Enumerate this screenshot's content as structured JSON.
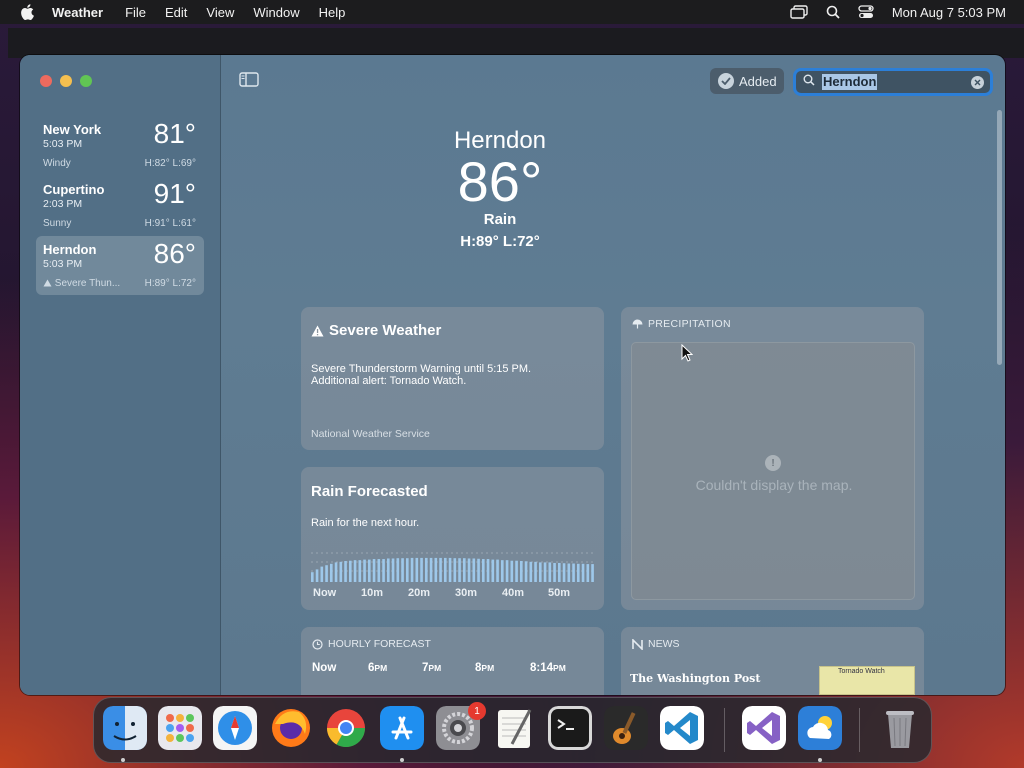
{
  "menubar": {
    "app_name": "Weather",
    "items": [
      "File",
      "Edit",
      "View",
      "Window",
      "Help"
    ],
    "clock": "Mon Aug 7  5:03 PM"
  },
  "sidebar": {
    "cities": [
      {
        "name": "New York",
        "time": "5:03 PM",
        "temp": "81°",
        "condition": "Windy",
        "hilo": "H:82°  L:69°"
      },
      {
        "name": "Cupertino",
        "time": "2:03 PM",
        "temp": "91°",
        "condition": "Sunny",
        "hilo": "H:91°  L:61°"
      },
      {
        "name": "Herndon",
        "time": "5:03 PM",
        "temp": "86°",
        "condition": "Severe Thun...",
        "hilo": "H:89°  L:72°"
      }
    ]
  },
  "toolbar": {
    "added_label": "Added",
    "search_value": "Herndon"
  },
  "current": {
    "city": "Herndon",
    "temp": "86°",
    "condition": "Rain",
    "hilo": "H:89°  L:72°"
  },
  "severe": {
    "title": "Severe Weather",
    "line1": "Severe Thunderstorm Warning until 5:15 PM.",
    "line2": "Additional alert: Tornado Watch.",
    "source": "National Weather Service"
  },
  "rain": {
    "title": "Rain Forecasted",
    "desc": "Rain for the next hour.",
    "ticks": [
      "Now",
      "10m",
      "20m",
      "30m",
      "40m",
      "50m"
    ],
    "intensity": [
      0.35,
      0.45,
      0.55,
      0.6,
      0.65,
      0.7,
      0.72,
      0.75,
      0.76,
      0.78,
      0.78,
      0.8,
      0.8,
      0.82,
      0.82,
      0.82,
      0.84,
      0.84,
      0.85,
      0.85,
      0.85,
      0.86,
      0.86,
      0.86,
      0.86,
      0.86,
      0.86,
      0.86,
      0.86,
      0.86,
      0.85,
      0.85,
      0.85,
      0.84,
      0.84,
      0.83,
      0.82,
      0.82,
      0.8,
      0.8,
      0.78,
      0.78,
      0.76,
      0.76,
      0.75,
      0.74,
      0.72,
      0.72,
      0.7,
      0.7,
      0.7,
      0.68,
      0.68,
      0.67,
      0.66,
      0.66,
      0.65,
      0.65,
      0.64,
      0.64
    ]
  },
  "precipitation": {
    "header": "PRECIPITATION",
    "message": "Couldn't display the map."
  },
  "hourly": {
    "header": "HOURLY FORECAST",
    "hours": [
      {
        "t": "Now",
        "s": ""
      },
      {
        "t": "6",
        "s": "PM"
      },
      {
        "t": "7",
        "s": "PM"
      },
      {
        "t": "8",
        "s": "PM"
      },
      {
        "t": "8:14",
        "s": "PM"
      }
    ]
  },
  "news": {
    "header": "NEWS",
    "publisher": "The Washington Post",
    "thumb_text": "Tornado Watch"
  },
  "dock": {
    "apps": [
      "Finder",
      "Launchpad",
      "Safari",
      "Firefox",
      "Chrome",
      "App Store",
      "System Settings",
      "TextEdit",
      "Terminal",
      "GarageBand",
      "Visual Studio Code",
      "Visual Studio",
      "Weather",
      "Trash"
    ],
    "settings_badge": "1"
  },
  "colors": {
    "accent": "#2c7fd8",
    "window_bg": "#5b7991",
    "rain_bar": "#9ec8ea"
  }
}
